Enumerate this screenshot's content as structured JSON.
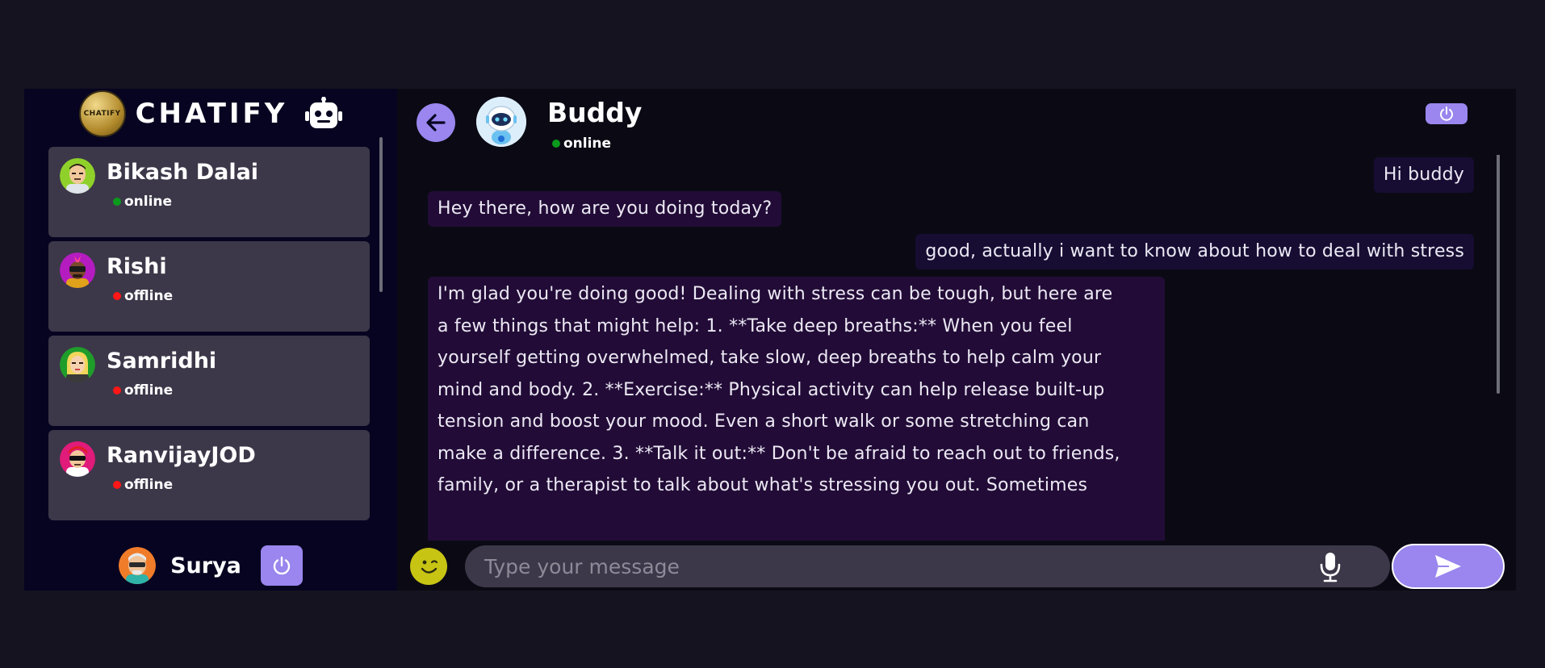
{
  "brand": {
    "name": "CHATIFY",
    "logo_text": "CHATIFY"
  },
  "contacts": [
    {
      "name": "Bikash Dalai",
      "status": "online",
      "status_color": "#0b9a1c"
    },
    {
      "name": "Rishi",
      "status": "offline",
      "status_color": "#ff1616"
    },
    {
      "name": "Samridhi",
      "status": "offline",
      "status_color": "#ff1616"
    },
    {
      "name": "RanvijayJOD",
      "status": "offline",
      "status_color": "#ff1616"
    }
  ],
  "current_user": {
    "name": "Surya"
  },
  "chat": {
    "bot_name": "Buddy",
    "bot_status": "online",
    "bot_status_color": "#0b9a1c",
    "messages": [
      {
        "from": "me",
        "text": "Hi buddy"
      },
      {
        "from": "bot",
        "text": "Hey there, how are you doing today?"
      },
      {
        "from": "me",
        "text": "good, actually i want to know about how to deal with stress"
      },
      {
        "from": "bot",
        "lines": [
          "I'm glad you're doing good! Dealing with stress can be tough, but here are",
          "a few things that might help: 1. **Take deep breaths:** When you feel",
          "yourself getting overwhelmed, take slow, deep breaths to help calm your",
          "mind and body. 2. **Exercise:** Physical activity can help release built-up",
          "tension and boost your mood. Even a short walk or some stretching can",
          "make a difference. 3. **Talk it out:** Don't be afraid to reach out to friends,",
          "family, or a therapist to talk about what's stressing you out. Sometimes"
        ]
      }
    ]
  },
  "composer": {
    "placeholder": "Type your message"
  },
  "colors": {
    "accent": "#9a86ee",
    "sidebar_bg": "#070421",
    "card_bg": "#3c3849",
    "page_bg": "#14131f",
    "chat_bg": "#0b0a14",
    "online": "#0b9a1c",
    "offline": "#ff1616"
  },
  "icons": {
    "brand_logo": "chatify-logo-icon",
    "robot": "robot-icon",
    "power": "power-icon",
    "back": "arrow-left-icon",
    "emoji": "smiley-icon",
    "mic": "microphone-icon",
    "send": "send-icon"
  }
}
